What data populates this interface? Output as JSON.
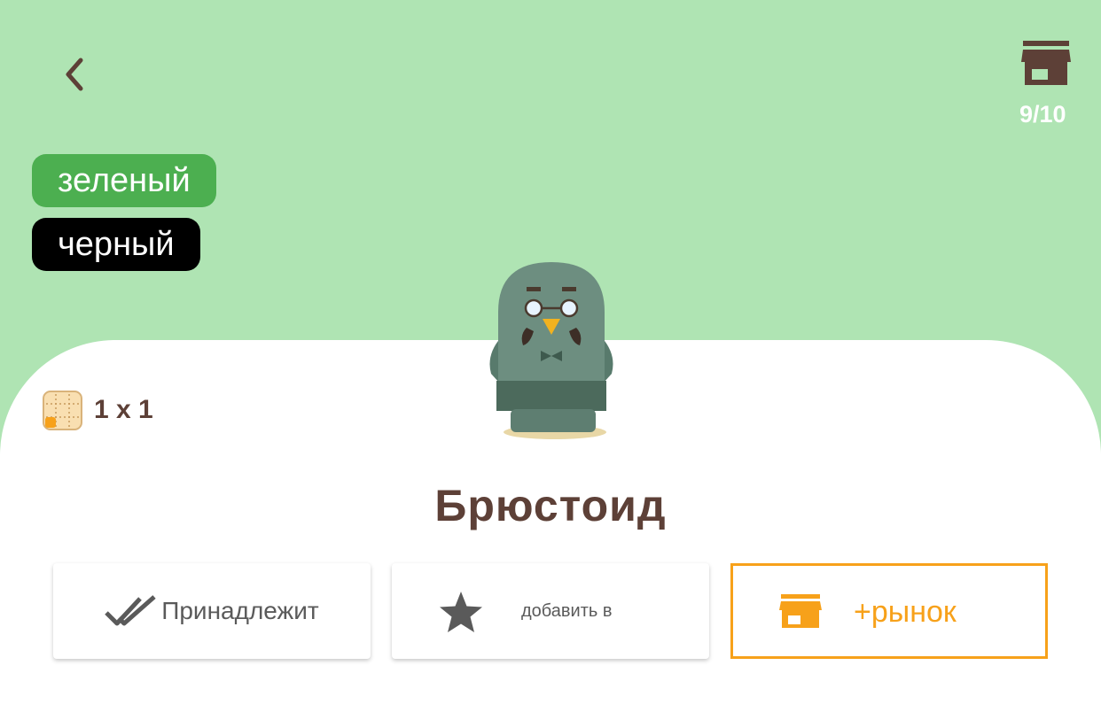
{
  "header": {
    "back_icon": "chevron-left-icon",
    "store_icon": "store-icon",
    "store_count": "9/10"
  },
  "tags": [
    {
      "label": "зеленый",
      "color": "#4caf50"
    },
    {
      "label": "черный",
      "color": "#000000"
    }
  ],
  "item": {
    "name": "Брюстоид",
    "size": "1 x 1",
    "size_icon": "grid-size-icon",
    "image_icon": "pigeon-figure-icon"
  },
  "actions": {
    "owned_label": "Принадлежит",
    "owned_icon": "double-check-icon",
    "favorite_label": "добавить в",
    "favorite_icon": "star-icon",
    "market_label": "+рынок",
    "market_icon": "store-icon"
  },
  "colors": {
    "header_bg": "#afe4b3",
    "brown": "#5d4037",
    "accent_orange": "#f7a11a"
  }
}
